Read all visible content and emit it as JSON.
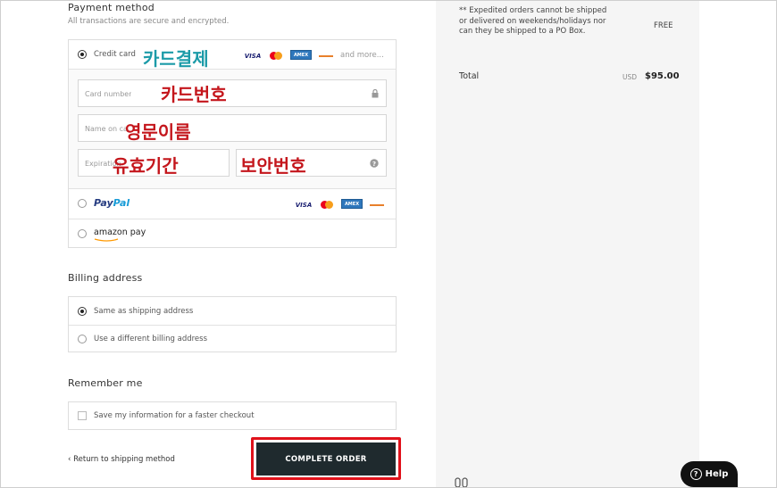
{
  "payment": {
    "title": "Payment method",
    "subtitle": "All transactions are secure and encrypted.",
    "credit_card_label": "Credit card",
    "and_more": "and more...",
    "card_number_ph": "Card number",
    "name_on_card_ph": "Name on card",
    "expiration_ph": "Expiration date",
    "paypal_label_a": "Pay",
    "paypal_label_b": "Pal",
    "amazon_label": "amazon pay",
    "card_logos": [
      "VISA",
      "MC",
      "AMEX",
      "DISCOVER"
    ]
  },
  "annotations": {
    "card_payment": "카드결제",
    "card_number": "카드번호",
    "english_name": "영문이름",
    "expiry": "유효기간",
    "security_code": "보안번호"
  },
  "billing": {
    "title": "Billing address",
    "same_label": "Same as shipping address",
    "different_label": "Use a different billing address"
  },
  "remember": {
    "title": "Remember me",
    "save_label": "Save my information for a faster checkout"
  },
  "actions": {
    "back_label": "‹ Return to shipping method",
    "complete_label": "COMPLETE ORDER"
  },
  "summary": {
    "note": "** Expedited orders cannot be shipped or delivered on weekends/holidays nor can they be shipped to a PO Box.",
    "shipping_value": "FREE",
    "total_label": "Total",
    "currency": "USD",
    "total_value": "$95.00"
  },
  "help": {
    "label": "Help"
  },
  "colors": {
    "button_bg": "#1f2a2e",
    "annotation_teal": "#1c9ba8",
    "annotation_red": "#c4161c",
    "highlight_outline": "#e0121b"
  }
}
